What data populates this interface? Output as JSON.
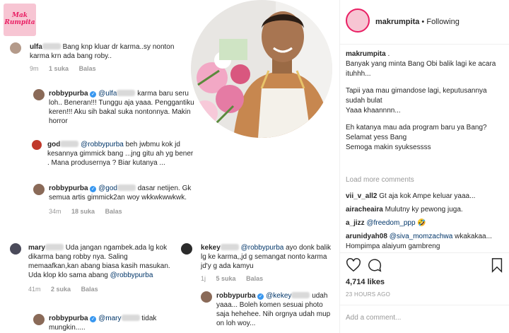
{
  "colors": {
    "accent": "#3897f0",
    "brand_pink": "#e91e63",
    "meta_gray": "#999999"
  },
  "logo": {
    "line1": "Mak",
    "line2": "Rumpita"
  },
  "left": {
    "c1": {
      "user": "ulfa",
      "text": "Bang knp kluar dr karma..sy nonton karma krn ada bang roby..",
      "time": "9m",
      "likes": "1 suka",
      "reply": "Balas"
    },
    "c2": {
      "user": "robbypurba",
      "mention": "@ulfa",
      "text": "karma baru seru loh.. Beneran!!! Tunggu aja yaaa. Penggantiku keren!!! Aku sih bakal suka nontonnya. Makin horror"
    },
    "c3": {
      "user": "god",
      "mention": "@robbypurba",
      "text": "beh jwbmu kok jd kesannya gimmick bang ...jng gitu ah yg bener . Mana produsernya ? Biar kutanya ..."
    },
    "c4": {
      "user": "robbypurba",
      "mention": "@god",
      "text": "dasar netijen. Gk semua artis gimmick2an woy wkkwkwwkwk.",
      "time": "34m",
      "likes": "18 suka",
      "reply": "Balas"
    },
    "c5": {
      "user": "mary",
      "text": "Uda jangan ngambek.ada lg kok dikarma bang robby nya. Saling memaafkan,kan abang biasa kasih masukan. Uda klop klo sama abang",
      "mention": "@robbypurba",
      "time": "41m",
      "likes": "2 suka",
      "reply": "Balas"
    },
    "c6": {
      "user": "robbypurba",
      "mention": "@mary",
      "text": "tidak mungkin....."
    },
    "c7": {
      "user": "kekey",
      "mention": "@robbypurba",
      "text": "ayo donk balik lg ke karma,,jd g semangat nonto karma jd'y g ada kamyu",
      "time": "1j",
      "likes": "5 suka",
      "reply": "Balas"
    },
    "c8": {
      "user": "robbypurba",
      "mention": "@kekey",
      "text": "udah yaaa... Boleh komen sesuai photo saja hehehee. Nih orgnya udah mup on loh woy..."
    }
  },
  "right": {
    "header": {
      "username": "makrumpita",
      "follow": "Following"
    },
    "caption": {
      "user": "makrumpita",
      "lines": [
        ".",
        "Banyak yang minta Bang Obi balik lagi ke acara ituhhh...",
        "Tapii yaa mau gimandose lagi, keputusannya sudah bulat",
        "Yaaa khaannnn...",
        "Eh katanya mau ada program baru ya Bang?",
        "Selamat yess Bang",
        "Semoga makin syuksessss"
      ]
    },
    "load_more": "Load more comments",
    "comments": [
      {
        "user": "vii_v_all2",
        "text": "Gt aja kok Ampe keluar yaaa..."
      },
      {
        "user": "airacheaira",
        "text": "Mulutny ky pewong juga."
      },
      {
        "user": "a_jizz",
        "mention": "@freedom_ppp",
        "emoji": "🤣"
      },
      {
        "user": "arunidyah08",
        "mention": "@siva_momzachwa",
        "text": "wkakakaa... Hompimpa alaiyum gambreng"
      }
    ],
    "likes": "4,714 likes",
    "time": "23 HOURS AGO",
    "add_comment": "Add a comment..."
  }
}
